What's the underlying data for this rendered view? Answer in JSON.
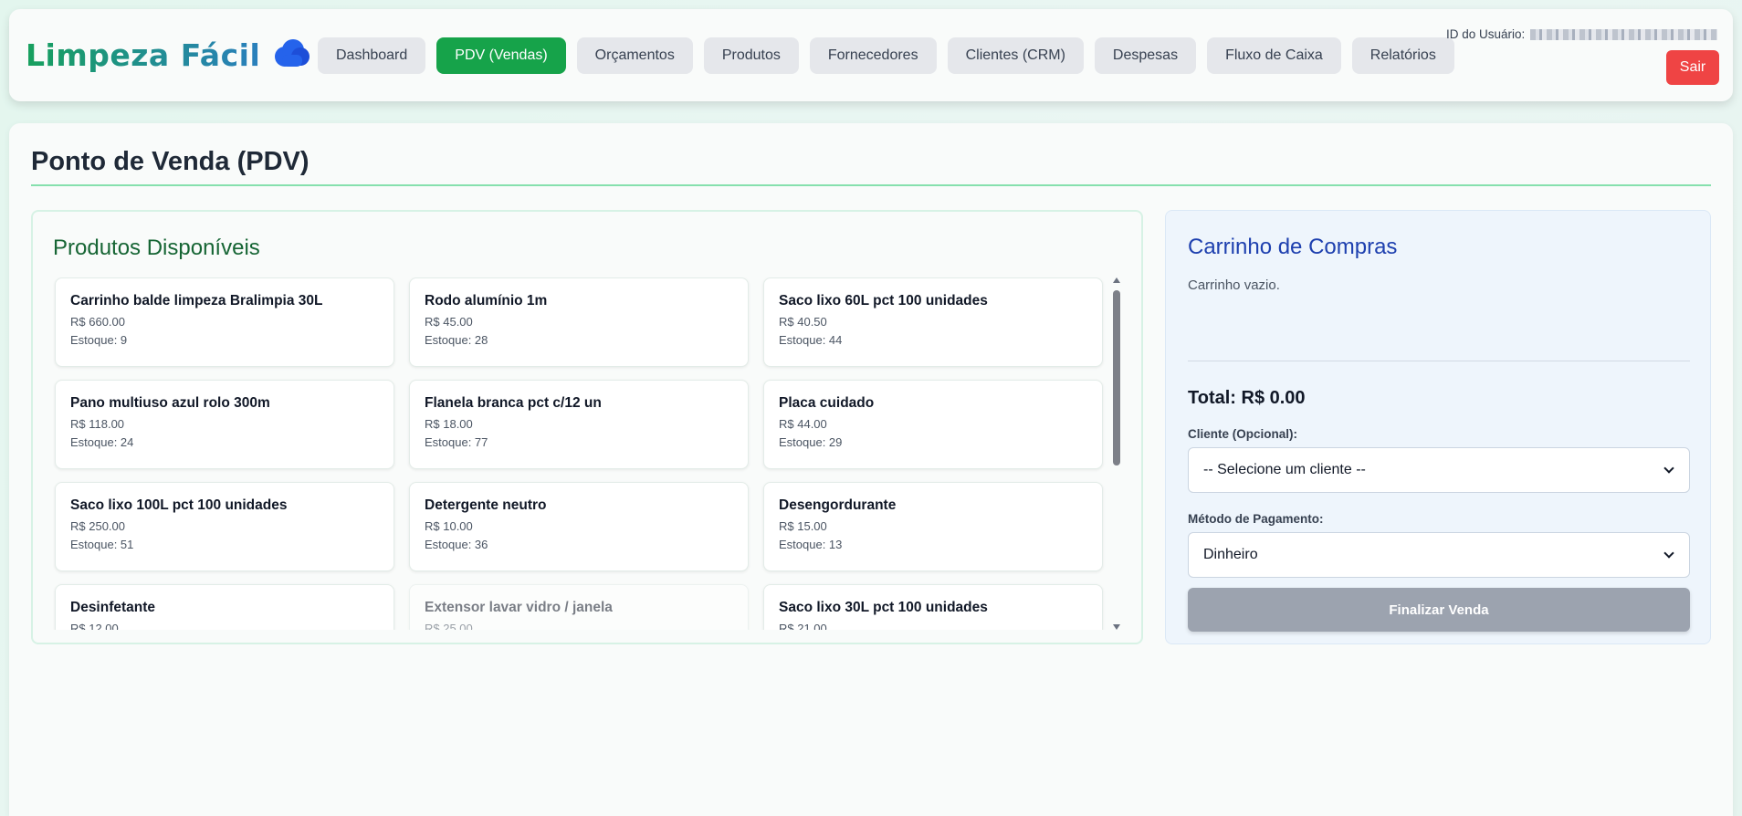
{
  "header": {
    "logo_text": "Limpeza Fácil",
    "logo_icon": "blue-cloud-icon",
    "user_id_label": "ID do Usuário:",
    "logout_label": "Sair"
  },
  "nav": [
    {
      "label": "Dashboard",
      "active": false
    },
    {
      "label": "PDV (Vendas)",
      "active": true
    },
    {
      "label": "Orçamentos",
      "active": false
    },
    {
      "label": "Produtos",
      "active": false
    },
    {
      "label": "Fornecedores",
      "active": false
    },
    {
      "label": "Clientes (CRM)",
      "active": false
    },
    {
      "label": "Despesas",
      "active": false
    },
    {
      "label": "Fluxo de Caixa",
      "active": false
    },
    {
      "label": "Relatórios",
      "active": false
    }
  ],
  "page": {
    "title": "Ponto de Venda (PDV)"
  },
  "products": {
    "title": "Produtos Disponíveis",
    "items": [
      {
        "name": "Carrinho balde limpeza Bralimpia 30L",
        "price": "R$ 660.00",
        "stock": "Estoque: 9"
      },
      {
        "name": "Rodo alumínio 1m",
        "price": "R$ 45.00",
        "stock": "Estoque: 28"
      },
      {
        "name": "Saco lixo 60L pct 100 unidades",
        "price": "R$ 40.50",
        "stock": "Estoque: 44"
      },
      {
        "name": "Pano multiuso azul rolo 300m",
        "price": "R$ 118.00",
        "stock": "Estoque: 24"
      },
      {
        "name": "Flanela branca pct c/12 un",
        "price": "R$ 18.00",
        "stock": "Estoque: 77"
      },
      {
        "name": "Placa cuidado",
        "price": "R$ 44.00",
        "stock": "Estoque: 29"
      },
      {
        "name": "Saco lixo 100L pct 100 unidades",
        "price": "R$ 250.00",
        "stock": "Estoque: 51"
      },
      {
        "name": "Detergente neutro",
        "price": "R$ 10.00",
        "stock": "Estoque: 36"
      },
      {
        "name": "Desengordurante",
        "price": "R$ 15.00",
        "stock": "Estoque: 13"
      },
      {
        "name": "Desinfetante",
        "price": "R$ 12.00",
        "stock": "",
        "dim": false
      },
      {
        "name": "Extensor lavar vidro / janela",
        "price": "R$ 25.00",
        "stock": "",
        "dim": true
      },
      {
        "name": "Saco lixo 30L pct 100 unidades",
        "price": "R$ 21.00",
        "stock": "",
        "dim": false
      }
    ]
  },
  "cart": {
    "title": "Carrinho de Compras",
    "empty_text": "Carrinho vazio.",
    "total_label": "Total: R$ 0.00",
    "client_label": "Cliente (Opcional):",
    "client_selected": "-- Selecione um cliente --",
    "payment_label": "Método de Pagamento:",
    "payment_selected": "Dinheiro",
    "finalize_label": "Finalizar Venda"
  },
  "colors": {
    "accent_green": "#16a34a",
    "logout_red": "#ef4444",
    "cart_title_blue": "#1e40af",
    "products_title_green": "#166534",
    "finalize_disabled": "#9ca3af"
  }
}
